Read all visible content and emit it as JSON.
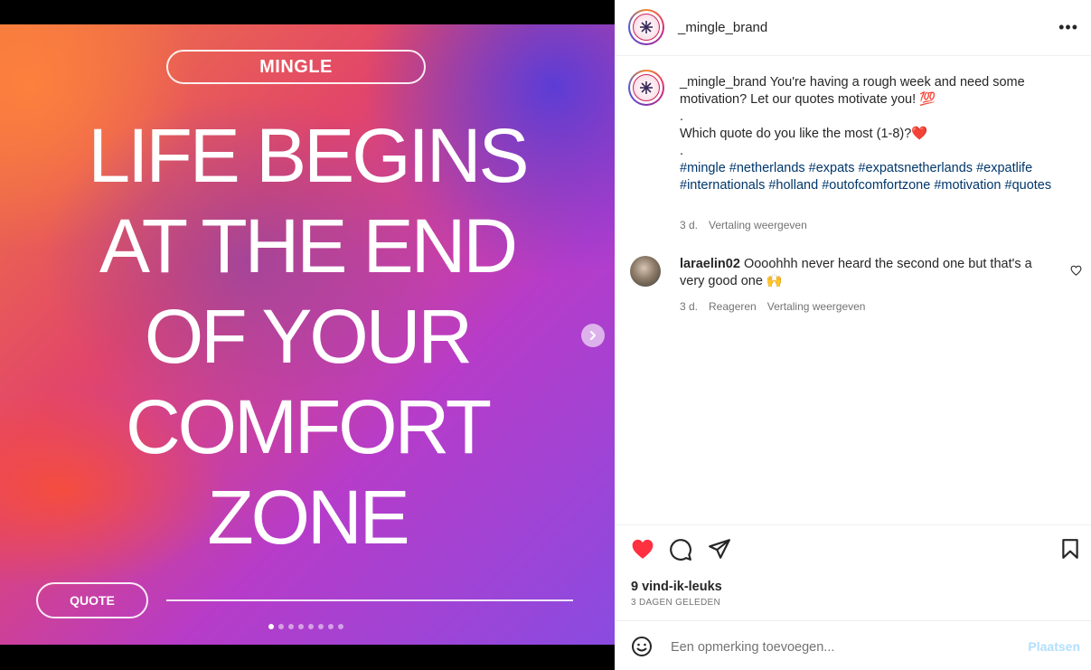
{
  "media": {
    "brand_pill": "MINGLE",
    "quote_lines": [
      "LIFE BEGINS",
      "AT THE END",
      "OF YOUR",
      "COMFORT",
      "ZONE"
    ],
    "quote_pill": "QUOTE",
    "slide_count": 8,
    "active_slide": 1
  },
  "header": {
    "username": "_mingle_brand",
    "more_icon": "more-horizontal-icon"
  },
  "caption": {
    "username": "_mingle_brand",
    "text": "You're having a rough week and need some motivation? Let our quotes motivate you! 💯",
    "dot1": ".",
    "question": "Which quote do you like the most (1-8)?❤️",
    "dot2": ".",
    "hashtags": "#mingle #netherlands #expats #expatsnetherlands #expatlife #internationals #holland #outofcomfortzone #motivation #quotes",
    "time": "3 d.",
    "translate": "Vertaling weergeven"
  },
  "comment": {
    "username": "laraelin02",
    "text": "Oooohhh never heard the second one but that's a very good one 🙌",
    "time": "3 d.",
    "reply": "Reageren",
    "translate": "Vertaling weergeven"
  },
  "actions": {
    "likes": "9 vind-ik-leuks",
    "posted": "3 DAGEN GELEDEN",
    "liked_color": "#ff3040"
  },
  "composer": {
    "placeholder": "Een opmerking toevoegen...",
    "post_label": "Plaatsen"
  }
}
